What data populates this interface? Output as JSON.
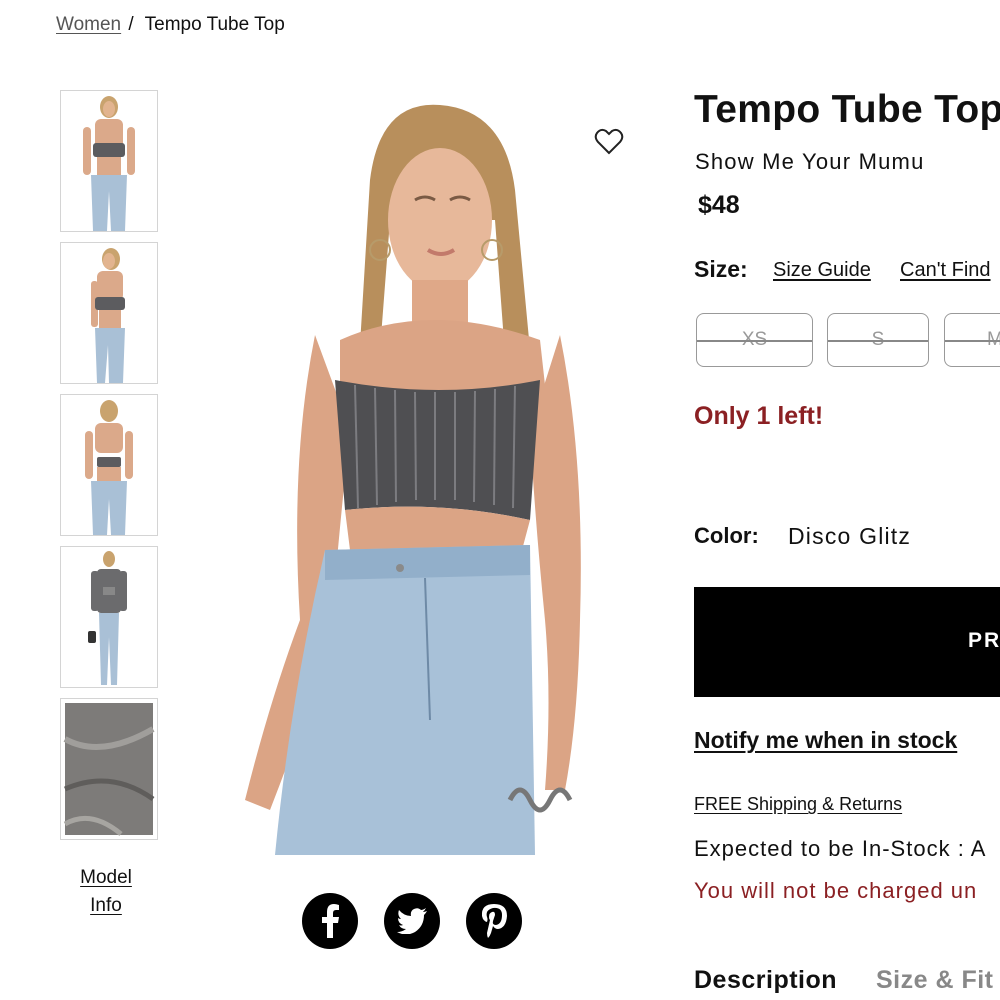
{
  "breadcrumb": {
    "parent": "Women",
    "separator": "/",
    "current": "Tempo Tube Top"
  },
  "thumbnails": [
    {
      "view": "front"
    },
    {
      "view": "side"
    },
    {
      "view": "back"
    },
    {
      "view": "full-outfit"
    },
    {
      "view": "fabric-detail"
    }
  ],
  "model_info_label_line1": "Model",
  "model_info_label_line2": "Info",
  "share_icons": [
    "facebook-icon",
    "twitter-icon",
    "pinterest-icon"
  ],
  "product": {
    "title": "Tempo Tube Top",
    "brand": "Show Me Your Mumu",
    "price": "$48",
    "size_label": "Size:",
    "size_guide": "Size Guide",
    "cant_find": "Can't Find",
    "sizes": [
      "XS",
      "S",
      "M"
    ],
    "stock_warning": "Only 1 left!",
    "color_label": "Color:",
    "color_value": "Disco Glitz",
    "cta_label": "PR",
    "notify": "Notify me when in stock",
    "shipping": "FREE Shipping & Returns",
    "expected": "Expected to be In-Stock : A",
    "charged_notice": "You will not be charged un"
  },
  "tabs": [
    "Description",
    "Size & Fit"
  ],
  "colors": {
    "accent_red": "#8b2023",
    "cta_bg": "#000000",
    "border": "#999999"
  }
}
